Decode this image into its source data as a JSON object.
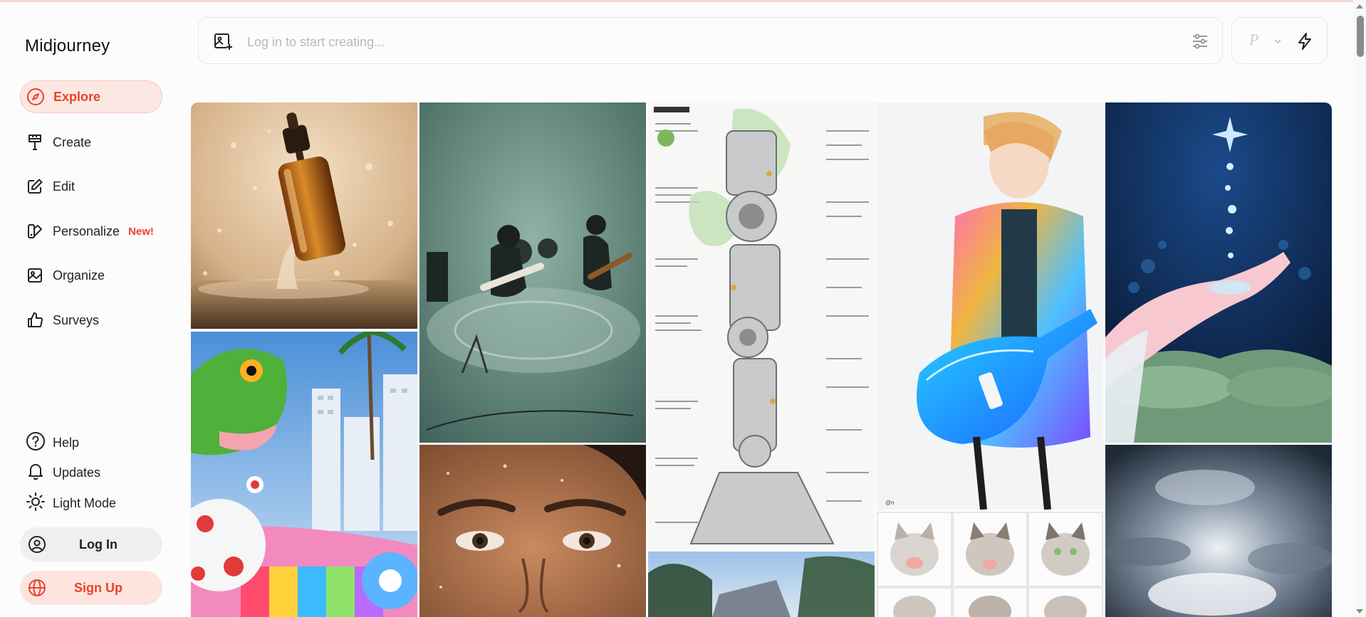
{
  "app": {
    "name": "Midjourney"
  },
  "colors": {
    "accent": "#e8432b",
    "active_bg": "#fde7e2"
  },
  "nav": {
    "items": [
      {
        "label": "Explore",
        "icon": "compass-icon",
        "active": true
      },
      {
        "label": "Create",
        "icon": "paintbrush-icon"
      },
      {
        "label": "Edit",
        "icon": "edit-icon"
      },
      {
        "label": "Personalize",
        "icon": "personalize-icon",
        "badge": "New!"
      },
      {
        "label": "Organize",
        "icon": "image-icon"
      },
      {
        "label": "Surveys",
        "icon": "thumbs-up-icon"
      }
    ]
  },
  "utility": {
    "help": "Help",
    "updates": "Updates",
    "light_mode": "Light Mode"
  },
  "auth": {
    "login": "Log In",
    "signup": "Sign Up"
  },
  "prompt": {
    "placeholder": "Log in to start creating..."
  },
  "mode": {
    "personalization": "P"
  },
  "gallery": {
    "images": [
      {
        "subject": "amber serum bottle splashing in water"
      },
      {
        "subject": "band playing guitars in a hazy green room"
      },
      {
        "subject": "robot leg technical diagram sheet"
      },
      {
        "subject": "anime girl with neon electric guitar"
      },
      {
        "subject": "anime hand with glowing water droplets over lily pads"
      },
      {
        "subject": "green cartoon snake in colorful game city"
      },
      {
        "subject": "close-up of a smiling face with water droplets"
      },
      {
        "subject": "sunlit clouds in a dark sky"
      },
      {
        "subject": "blurred trees and sky"
      },
      {
        "subject": "grid of cartoon kittens"
      }
    ]
  }
}
